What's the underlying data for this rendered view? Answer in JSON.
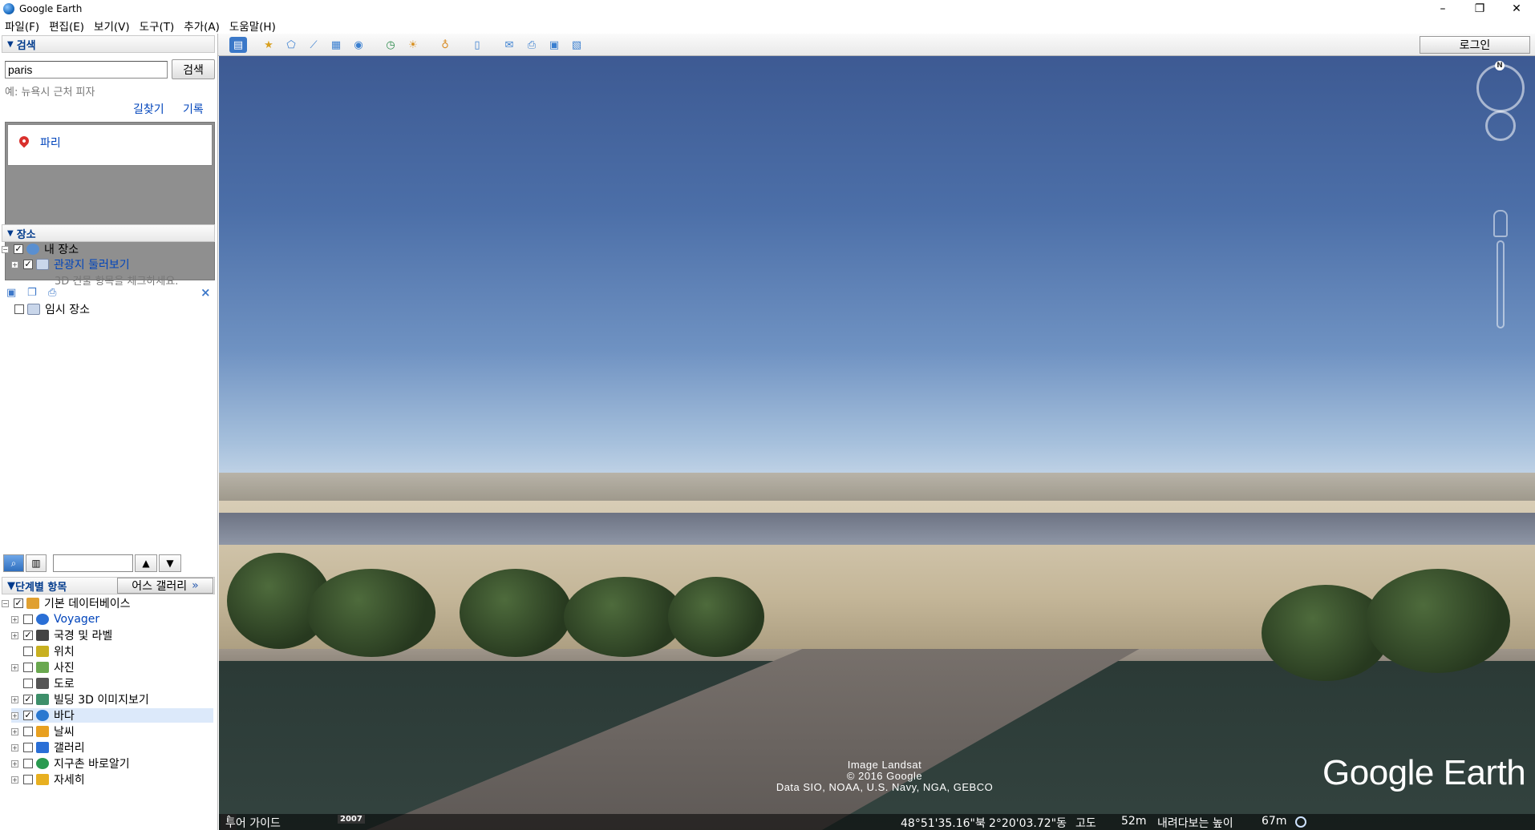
{
  "window": {
    "title": "Google Earth",
    "controls": [
      "–",
      "❐",
      "✕"
    ]
  },
  "menu": [
    "파일(F)",
    "편집(E)",
    "보기(V)",
    "도구(T)",
    "추가(A)",
    "도움말(H)"
  ],
  "search_panel": {
    "header": "검색",
    "input_value": "paris",
    "search_button": "검색",
    "hint": "예: 뉴욕시 근처 피자",
    "directions_link": "길찾기",
    "history_link": "기록",
    "result": "파리"
  },
  "places_panel": {
    "header": "장소",
    "my_places": "내 장소",
    "tour_folder": "관광지 둘러보기",
    "tour_hint": "3D 건물 항목을 체크하세요.",
    "temp_places": "임시 장소"
  },
  "layers_panel": {
    "header": "단계별 항목",
    "gallery_button": "어스 갤러리",
    "gallery_chevron": "»",
    "items": [
      {
        "label": "기본 데이터베이스",
        "checked": true,
        "color": "#e0a030"
      },
      {
        "label": "Voyager",
        "checked": false,
        "color": "#2a6fd6",
        "link": true
      },
      {
        "label": "국경 및 라벨",
        "checked": true,
        "color": "#444444"
      },
      {
        "label": "위치",
        "checked": false,
        "color": "#c8b020"
      },
      {
        "label": "사진",
        "checked": false,
        "color": "#6aa84f"
      },
      {
        "label": "도로",
        "checked": false,
        "color": "#555555"
      },
      {
        "label": "빌딩 3D 이미지보기",
        "checked": true,
        "color": "#3d8f6a"
      },
      {
        "label": "바다",
        "checked": true,
        "color": "#2a78d0",
        "highlight": true
      },
      {
        "label": "날씨",
        "checked": false,
        "color": "#e8a020"
      },
      {
        "label": "갤러리",
        "checked": false,
        "color": "#2a6fd6"
      },
      {
        "label": "지구촌 바로알기",
        "checked": false,
        "color": "#2a9a50"
      },
      {
        "label": "자세히",
        "checked": false,
        "color": "#e8b020"
      }
    ]
  },
  "toolbar": {
    "login_button": "로그인"
  },
  "view": {
    "attribution": [
      "Image Landsat",
      "© 2016 Google",
      "Data SIO, NOAA, U.S. Navy, NGA, GEBCO"
    ],
    "watermark": "Google Earth",
    "north_label": "N"
  },
  "statusbar": {
    "tour_guide": "투어 가이드",
    "year": "2007",
    "lat": "48°51'35.16\"북",
    "lon": "2°20'03.72\"동",
    "elev_label": "고도",
    "elev": "52m",
    "eye_label": "내려다보는 높이",
    "eye": "67m"
  }
}
